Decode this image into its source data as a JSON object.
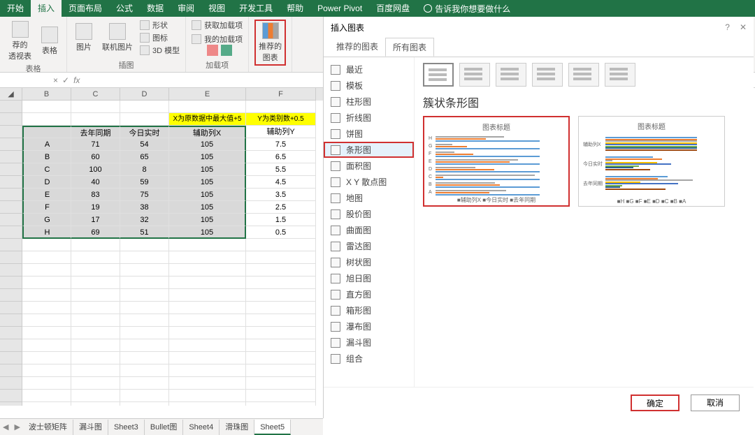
{
  "ribbon": {
    "tabs": [
      "开始",
      "插入",
      "页面布局",
      "公式",
      "数据",
      "审阅",
      "视图",
      "开发工具",
      "帮助",
      "Power Pivot",
      "百度网盘"
    ],
    "active_tab": 1,
    "tell_me": "告诉我你想要做什么",
    "groups": {
      "tables": {
        "pivot": "荐的\n透视表",
        "table": "表格",
        "label": "表格"
      },
      "illustrations": {
        "pic": "图片",
        "online_pic": "联机图片",
        "shapes": "形状",
        "icons": "图标",
        "model": "3D 模型",
        "label": "插图"
      },
      "addins": {
        "get": "获取加载项",
        "my": "我的加载项",
        "label": "加载项"
      },
      "charts": {
        "rec": "推荐的\n图表"
      }
    }
  },
  "formula_bar": {
    "name": "",
    "fx": "fx",
    "value": ""
  },
  "columns": [
    "",
    "B",
    "C",
    "D",
    "E",
    "F"
  ],
  "note": {
    "e": "X为原数据中最大值+5",
    "f": "Y为类别数+0.5"
  },
  "headers": {
    "b": "",
    "c": "去年同期",
    "d": "今日实时",
    "e": "辅助列X",
    "f": "辅助列Y"
  },
  "rows": [
    {
      "b": "A",
      "c": 71,
      "d": 54,
      "e": 105,
      "f": 7.5
    },
    {
      "b": "B",
      "c": 60,
      "d": 65,
      "e": 105,
      "f": 6.5
    },
    {
      "b": "C",
      "c": 100,
      "d": 8,
      "e": 105,
      "f": 5.5
    },
    {
      "b": "D",
      "c": 40,
      "d": 59,
      "e": 105,
      "f": 4.5
    },
    {
      "b": "E",
      "c": 83,
      "d": 75,
      "e": 105,
      "f": 3.5
    },
    {
      "b": "F",
      "c": 19,
      "d": 38,
      "e": 105,
      "f": 2.5
    },
    {
      "b": "G",
      "c": 17,
      "d": 32,
      "e": 105,
      "f": 1.5
    },
    {
      "b": "H",
      "c": 69,
      "d": 51,
      "e": 105,
      "f": 0.5
    }
  ],
  "dialog": {
    "title": "插入图表",
    "tabs": [
      "推荐的图表",
      "所有图表"
    ],
    "active_tab": 1,
    "types": [
      "最近",
      "模板",
      "柱形图",
      "折线图",
      "饼图",
      "条形图",
      "面积图",
      "X Y 散点图",
      "地图",
      "股价图",
      "曲面图",
      "雷达图",
      "树状图",
      "旭日图",
      "直方图",
      "箱形图",
      "瀑布图",
      "漏斗图",
      "组合"
    ],
    "selected_type": 5,
    "subtype_title": "簇状条形图",
    "preview_title": "图表标题",
    "legend1": "■辅助列X ■今日实时 ■去年同期",
    "legend2": "■H ■G ■F ■E ■D ■C ■B ■A",
    "preview_ylabels": [
      "H",
      "G",
      "F",
      "E",
      "D",
      "C",
      "B",
      "A"
    ],
    "preview2_ylabels": [
      "辅助列X",
      "今日实时",
      "去年同期"
    ],
    "ok": "确定",
    "cancel": "取消"
  },
  "sheet_tabs": [
    "波士顿矩阵",
    "漏斗图",
    "Sheet3",
    "Bullet图",
    "Sheet4",
    "滑珠图",
    "Sheet5"
  ],
  "active_sheet": 6,
  "chart_data": {
    "type": "bar",
    "categories": [
      "A",
      "B",
      "C",
      "D",
      "E",
      "F",
      "G",
      "H"
    ],
    "series": [
      {
        "name": "去年同期",
        "values": [
          71,
          60,
          100,
          40,
          83,
          19,
          17,
          69
        ]
      },
      {
        "name": "今日实时",
        "values": [
          54,
          65,
          8,
          59,
          75,
          38,
          32,
          51
        ]
      },
      {
        "name": "辅助列X",
        "values": [
          105,
          105,
          105,
          105,
          105,
          105,
          105,
          105
        ]
      }
    ],
    "title": "图表标题",
    "xlim": [
      0,
      120
    ]
  }
}
